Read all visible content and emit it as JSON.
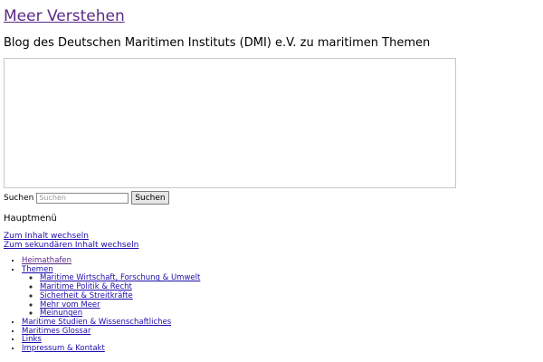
{
  "site": {
    "title": "Meer Verstehen",
    "description": "Blog des Deutschen Maritimen Instituts (DMI) e.V. zu maritimen Themen"
  },
  "search": {
    "label": "Suchen",
    "placeholder": "Suchen",
    "button": "Suchen"
  },
  "main_menu": {
    "heading": "Hauptmenü",
    "skip_links": [
      "Zum Inhalt wechseln",
      "Zum sekundären Inhalt wechseln"
    ],
    "items": [
      {
        "label": "Heimathafen"
      },
      {
        "label": "Themen",
        "children": [
          "Maritime Wirtschaft, Forschung & Umwelt",
          "Maritime Politik & Recht",
          "Sicherheit & Streitkräfte",
          "Mehr vom Meer",
          "Meinungen"
        ]
      },
      {
        "label": "Maritime Studien & Wissenschaftliches"
      },
      {
        "label": "Maritimes Glossar"
      },
      {
        "label": "Links"
      },
      {
        "label": "Impressum & Kontakt"
      }
    ]
  },
  "colors": {
    "link": "#1a0dab",
    "visited_link": "#5b2a86"
  }
}
